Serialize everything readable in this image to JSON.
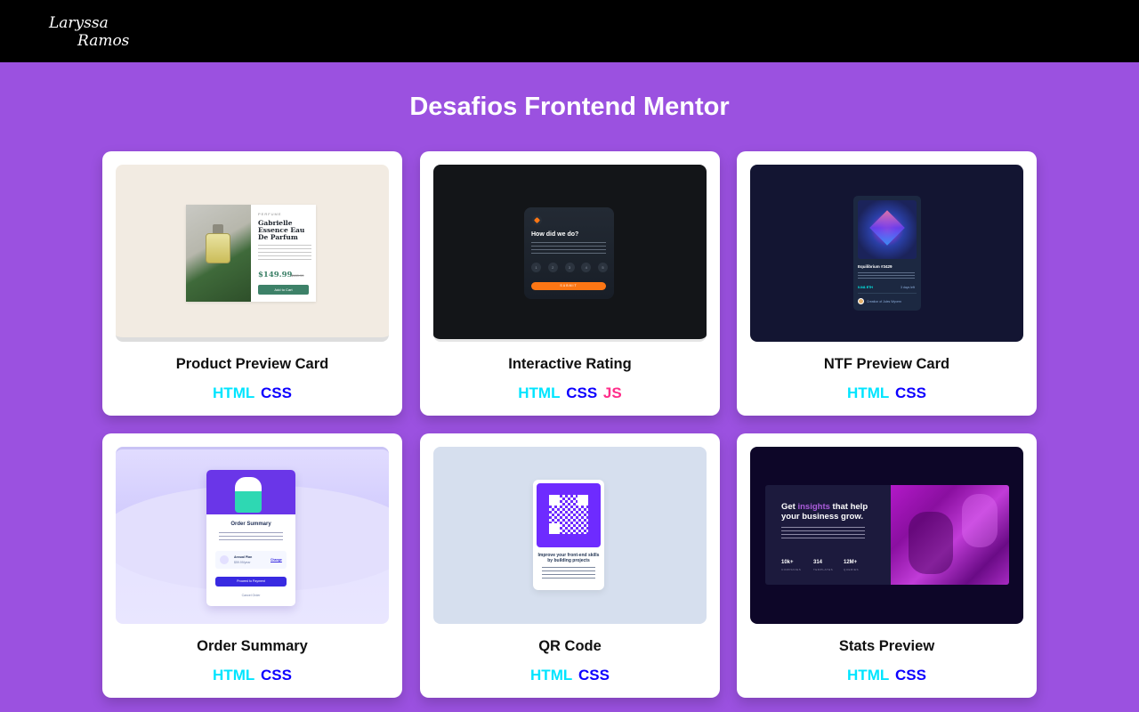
{
  "header": {
    "logo_line1": "Laryssa",
    "logo_line2": "Ramos"
  },
  "page": {
    "title": "Desafios Frontend Mentor"
  },
  "projects": [
    {
      "name": "Product Preview Card",
      "tags": [
        "HTML",
        "CSS"
      ],
      "preview": {
        "category": "PERFUME",
        "title": "Gabrielle Essence Eau De Parfum",
        "price": "$149.99",
        "old_price": "$169.99",
        "button": "Add to Cart"
      }
    },
    {
      "name": "Interactive Rating",
      "tags": [
        "HTML",
        "CSS",
        "JS"
      ],
      "preview": {
        "question": "How did we do?",
        "numbers": [
          "1",
          "2",
          "3",
          "4",
          "5"
        ],
        "button": "SUBMIT"
      }
    },
    {
      "name": "NTF Preview Card",
      "tags": [
        "HTML",
        "CSS"
      ],
      "preview": {
        "title": "Equilibrium #3429",
        "eth": "0.041 ETH",
        "days": "3 days left",
        "creator": "Creation of Jules Wyvern"
      }
    },
    {
      "name": "Order Summary",
      "tags": [
        "HTML",
        "CSS"
      ],
      "preview": {
        "title": "Order Summary",
        "plan": "Annual Plan",
        "plan_price": "$59.99/year",
        "change": "Change",
        "pay_button": "Proceed to Payment",
        "cancel": "Cancel Order"
      }
    },
    {
      "name": "QR Code",
      "tags": [
        "HTML",
        "CSS"
      ],
      "preview": {
        "title": "Improve your front-end skills by building projects"
      }
    },
    {
      "name": "Stats Preview",
      "tags": [
        "HTML",
        "CSS"
      ],
      "preview": {
        "heading_before": "Get ",
        "heading_highlight": "insights",
        "heading_after": " that help your business grow.",
        "stats": [
          {
            "value": "10k+",
            "label": "COMPANIES"
          },
          {
            "value": "314",
            "label": "TEMPLATES"
          },
          {
            "value": "12M+",
            "label": "QUERIES"
          }
        ]
      }
    }
  ],
  "colors": {
    "background": "#9b51e0",
    "header": "#000000",
    "tag_html": "#00e5ff",
    "tag_css": "#0d00ff",
    "tag_js": "#ff2d8a"
  }
}
